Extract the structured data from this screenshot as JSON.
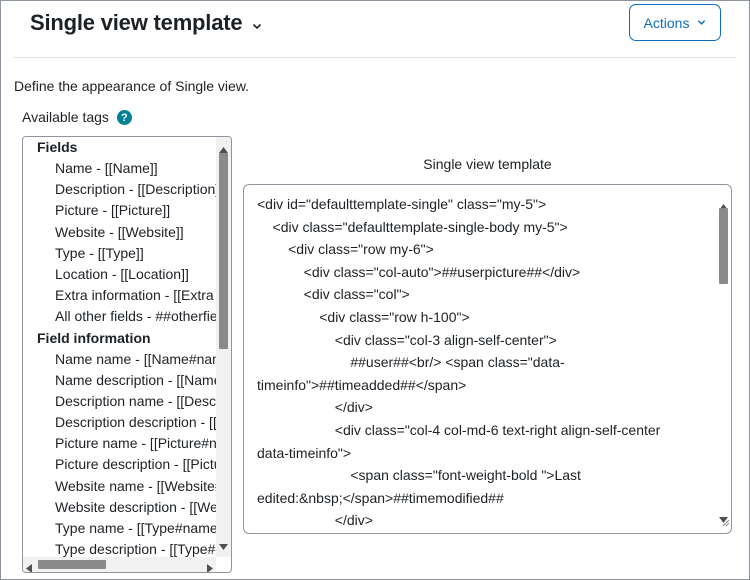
{
  "header": {
    "title": "Single view template",
    "actions_label": "Actions"
  },
  "description": "Define the appearance of Single view.",
  "tags": {
    "label": "Available tags",
    "help_glyph": "?",
    "groups": [
      {
        "title": "Fields",
        "items": [
          "Name - [[Name]]",
          "Description - [[Description]]",
          "Picture - [[Picture]]",
          "Website - [[Website]]",
          "Type - [[Type]]",
          "Location - [[Location]]",
          "Extra information - [[Extra information]]",
          "All other fields - ##otherfields##"
        ]
      },
      {
        "title": "Field information",
        "items": [
          "Name name - [[Name#name]]",
          "Name description - [[Name#description]]",
          "Description name - [[Description#name]]",
          "Description description - [[Description#description]]",
          "Picture name - [[Picture#name]]",
          "Picture description - [[Picture#description]]",
          "Website name - [[Website#name]]",
          "Website description - [[Website#description]]",
          "Type name - [[Type#name]]",
          "Type description - [[Type#description]]"
        ]
      }
    ]
  },
  "editor": {
    "label": "Single view template",
    "lines": [
      "<div id=\"defaulttemplate-single\" class=\"my-5\">",
      "    <div class=\"defaulttemplate-single-body my-5\">",
      "        <div class=\"row my-6\">",
      "            <div class=\"col-auto\">##userpicture##</div>",
      "            <div class=\"col\">",
      "                <div class=\"row h-100\">",
      "                    <div class=\"col-3 align-self-center\">",
      "                        ##user##<br/> <span class=\"data-",
      "timeinfo\">##timeadded##</span>",
      "                    </div>",
      "                    <div class=\"col-4 col-md-6 text-right align-self-center",
      "data-timeinfo\">",
      "                        <span class=\"font-weight-bold \">Last",
      "edited:&nbsp;</span>##timemodified##",
      "                    </div>"
    ]
  },
  "colors": {
    "accent": "#0f6cbf",
    "help_icon_bg": "#008196",
    "border": "#8f959e",
    "scroll_thumb": "#8a8a8a",
    "text": "#1d2125"
  }
}
